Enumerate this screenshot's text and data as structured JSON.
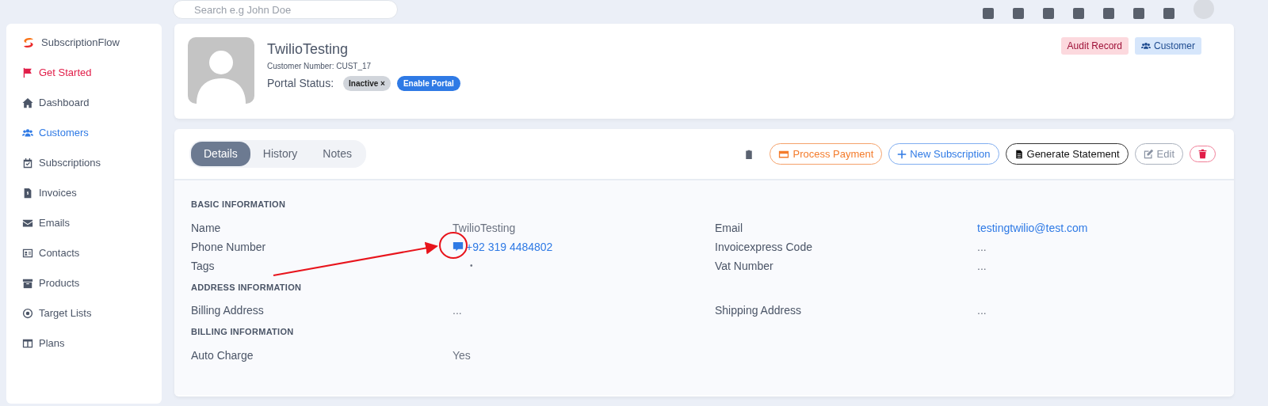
{
  "search": {
    "placeholder": "Search e.g John Doe"
  },
  "sidebar": {
    "brand": "SubscriptionFlow",
    "items": [
      {
        "label": "Get Started",
        "kind": "accent",
        "selected": false
      },
      {
        "label": "Dashboard",
        "kind": "link",
        "selected": false
      },
      {
        "label": "Customers",
        "kind": "link",
        "selected": true
      },
      {
        "label": "Subscriptions",
        "kind": "link",
        "selected": false
      },
      {
        "label": "Invoices",
        "kind": "link",
        "selected": false
      },
      {
        "label": "Emails",
        "kind": "link",
        "selected": false
      },
      {
        "label": "Contacts",
        "kind": "link",
        "selected": false
      },
      {
        "label": "Products",
        "kind": "link",
        "selected": false
      },
      {
        "label": "Target Lists",
        "kind": "link",
        "selected": false
      },
      {
        "label": "Plans",
        "kind": "link",
        "selected": false
      }
    ]
  },
  "customer": {
    "name": "TwilioTesting",
    "number": "Customer Number: CUST_17",
    "portal_label": "Portal Status:",
    "status": {
      "label": "Inactive",
      "remove": "×"
    },
    "enable_button": "Enable Portal",
    "badges": [
      {
        "label": "Audit Record",
        "kind": "audit"
      },
      {
        "label": "Customer",
        "kind": "role"
      }
    ]
  },
  "tabs": [
    {
      "label": "Details",
      "selected": true
    },
    {
      "label": "History",
      "selected": false
    },
    {
      "label": "Notes",
      "selected": false
    }
  ],
  "actions": [
    {
      "kind": "clipboard"
    },
    {
      "kind": "payment",
      "label": "Process Payment"
    },
    {
      "kind": "subscription",
      "label": "New Subscription"
    },
    {
      "kind": "statement",
      "label": "Generate Statement"
    },
    {
      "kind": "edit",
      "label": "Edit"
    },
    {
      "kind": "delete"
    }
  ],
  "sections": [
    {
      "title": "BASIC INFORMATION",
      "fields": [
        {
          "label": "Name",
          "value": "TwilioTesting",
          "kind": "text"
        },
        {
          "label": "Email",
          "value": "testingtwilio@test.com",
          "kind": "link"
        },
        {
          "label": "Phone Number",
          "value": "+92 319 4484802",
          "kind": "phone"
        },
        {
          "label": "Invoicexpress Code",
          "value": "...",
          "kind": "text"
        },
        {
          "label": "Tags",
          "value": "•",
          "kind": "tags"
        },
        {
          "label": "Vat Number",
          "value": "...",
          "kind": "text"
        }
      ]
    },
    {
      "title": "ADDRESS INFORMATION",
      "fields": [
        {
          "label": "Billing Address",
          "value": "...",
          "kind": "text"
        },
        {
          "label": "Shipping Address",
          "value": "...",
          "kind": "text"
        }
      ]
    },
    {
      "title": "BILLING INFORMATION",
      "fields": [
        {
          "label": "Auto Charge",
          "value": "Yes",
          "kind": "text"
        }
      ]
    }
  ]
}
